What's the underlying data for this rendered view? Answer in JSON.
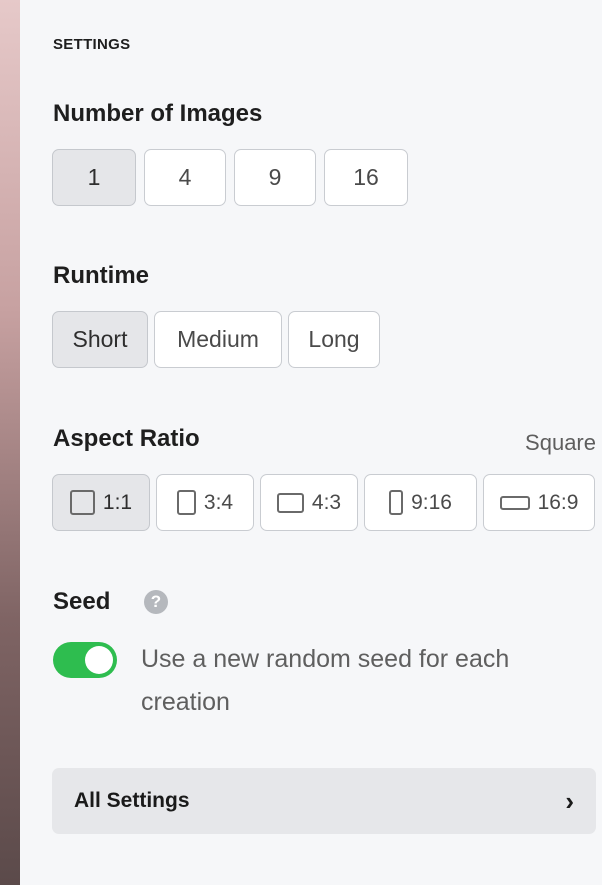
{
  "header": {
    "title": "SETTINGS"
  },
  "num_images": {
    "label": "Number of Images",
    "options": [
      "1",
      "4",
      "9",
      "16"
    ],
    "selected": "1"
  },
  "runtime": {
    "label": "Runtime",
    "options": [
      "Short",
      "Medium",
      "Long"
    ],
    "selected": "Short"
  },
  "aspect_ratio": {
    "label": "Aspect Ratio",
    "current_value": "Square",
    "options": [
      {
        "label": "1:1",
        "icon": "square-icon"
      },
      {
        "label": "3:4",
        "icon": "portrait-3-4-icon"
      },
      {
        "label": "4:3",
        "icon": "landscape-4-3-icon"
      },
      {
        "label": "9:16",
        "icon": "portrait-9-16-icon"
      },
      {
        "label": "16:9",
        "icon": "landscape-16-9-icon"
      }
    ],
    "selected": "1:1"
  },
  "seed": {
    "label": "Seed",
    "help_icon": "question-mark-icon",
    "help_glyph": "?",
    "toggle_on": true,
    "toggle_label": "Use a new random seed for each creation",
    "accent_color": "#2ebd4f"
  },
  "footer": {
    "all_settings_label": "All Settings",
    "chevron_glyph": "›"
  }
}
